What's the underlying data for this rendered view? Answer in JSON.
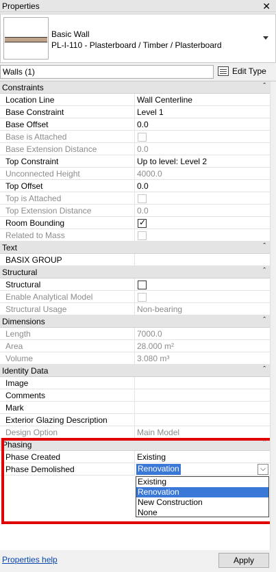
{
  "window": {
    "title": "Properties",
    "close_glyph": "✕"
  },
  "type_selector": {
    "family": "Basic Wall",
    "type": "PL-I-110 - Plasterboard / Timber / Plasterboard",
    "arrow": "dropdown-arrow"
  },
  "filter": {
    "value": "Walls (1)",
    "chevron": "⌵",
    "edit_type_label": "Edit Type"
  },
  "groups": {
    "constraints": "Constraints",
    "text": "Text",
    "structural": "Structural",
    "dimensions": "Dimensions",
    "identity": "Identity Data",
    "phasing": "Phasing",
    "collapse_glyph": "ˆ"
  },
  "props": {
    "location_line": {
      "name": "Location Line",
      "value": "Wall Centerline"
    },
    "base_constraint": {
      "name": "Base Constraint",
      "value": "Level 1"
    },
    "base_offset": {
      "name": "Base Offset",
      "value": "0.0"
    },
    "base_attached": {
      "name": "Base is Attached"
    },
    "base_ext": {
      "name": "Base Extension Distance",
      "value": "0.0"
    },
    "top_constraint": {
      "name": "Top Constraint",
      "value": "Up to level: Level 2"
    },
    "unconnected_height": {
      "name": "Unconnected Height",
      "value": "4000.0"
    },
    "top_offset": {
      "name": "Top Offset",
      "value": "0.0"
    },
    "top_attached": {
      "name": "Top is Attached"
    },
    "top_ext": {
      "name": "Top Extension Distance",
      "value": "0.0"
    },
    "room_bounding": {
      "name": "Room Bounding",
      "checked": true
    },
    "related_mass": {
      "name": "Related to Mass"
    },
    "basix_group": {
      "name": "BASIX GROUP",
      "value": ""
    },
    "structural": {
      "name": "Structural",
      "checked": false
    },
    "analytical": {
      "name": "Enable Analytical Model"
    },
    "structural_usage": {
      "name": "Structural Usage",
      "value": "Non-bearing"
    },
    "length": {
      "name": "Length",
      "value": "7000.0"
    },
    "area": {
      "name": "Area",
      "value": "28.000 m²"
    },
    "volume": {
      "name": "Volume",
      "value": "3.080 m³"
    },
    "image": {
      "name": "Image"
    },
    "comments": {
      "name": "Comments"
    },
    "mark": {
      "name": "Mark"
    },
    "ext_glazing": {
      "name": "Exterior Glazing Description"
    },
    "design_option": {
      "name": "Design Option",
      "value": "Main Model"
    },
    "phase_created": {
      "name": "Phase Created",
      "value": "Existing"
    },
    "phase_demolished": {
      "name": "Phase Demolished",
      "value": "Renovation"
    }
  },
  "phase_dropdown": {
    "options": [
      "Existing",
      "Renovation",
      "New Construction",
      "None"
    ],
    "selected": "Renovation"
  },
  "footer": {
    "help_link": "Properties help",
    "apply_label": "Apply"
  },
  "colors": {
    "selection": "#3a78d8",
    "highlight_border": "#e00000",
    "group_bg": "#e4e4e4"
  }
}
